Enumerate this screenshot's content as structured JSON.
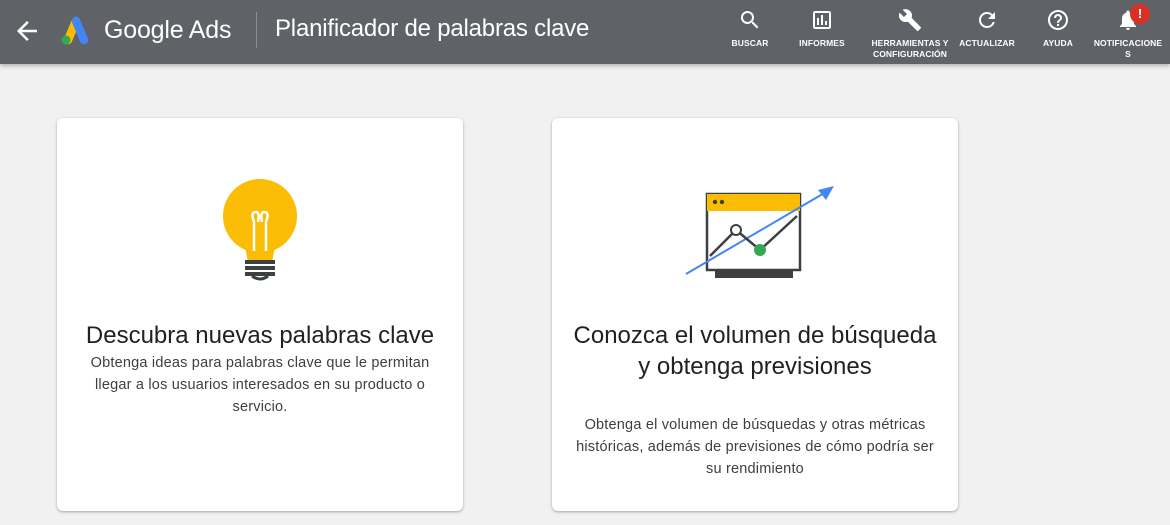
{
  "header": {
    "brand": "Google Ads",
    "page_title": "Planificador de palabras clave",
    "back_icon": "arrow-left-icon",
    "background_color": "#5f6368",
    "tools": [
      {
        "label": "BUSCAR",
        "icon": "search-icon"
      },
      {
        "label": "INFORMES",
        "icon": "report-chart-icon"
      },
      {
        "label": "HERRAMIENTAS Y CONFIGURACIÓN",
        "icon": "wrench-icon"
      },
      {
        "label": "ACTUALIZAR",
        "icon": "refresh-icon"
      },
      {
        "label": "AYUDA",
        "icon": "help-icon"
      },
      {
        "label": "NOTIFICACIONES",
        "icon": "bell-icon",
        "badge": "!"
      }
    ]
  },
  "cards": [
    {
      "title": "Descubra nuevas palabras clave",
      "description": "Obtenga ideas para palabras clave que le permitan llegar a los usuarios interesados en su producto o servicio.",
      "illustration": "lightbulb-icon"
    },
    {
      "title": "Conozca el volumen de búsqueda y obtenga previsiones",
      "description": "Obtenga el volumen de búsquedas y otras métricas históricas, además de previsiones de cómo podría ser su rendimiento",
      "illustration": "trend-chart-icon"
    }
  ],
  "colors": {
    "accent_yellow": "#fbbc04",
    "accent_blue": "#4285f4",
    "accent_green": "#34a853",
    "badge_red": "#d93025"
  }
}
